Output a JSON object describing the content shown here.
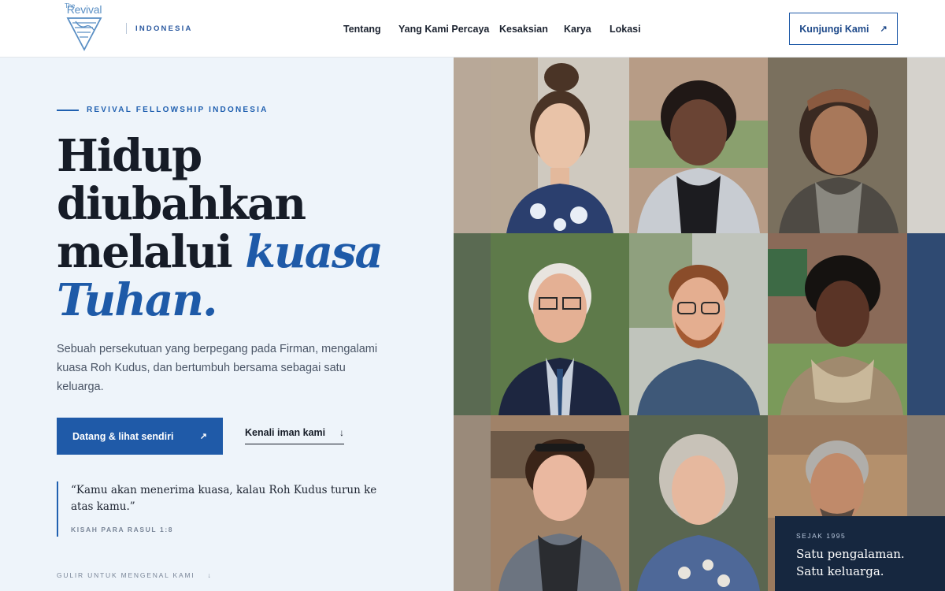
{
  "header": {
    "logo_text": "Revival",
    "logo_small": "The",
    "region": "INDONESIA",
    "nav": [
      {
        "label": "Tentang"
      },
      {
        "label": "Yang Kami Percaya"
      },
      {
        "label": "Kesaksian"
      },
      {
        "label": "Karya"
      },
      {
        "label": "Lokasi"
      }
    ],
    "cta_label": "Kunjungi Kami",
    "cta_icon": "arrow-up-right-icon"
  },
  "hero": {
    "eyebrow": "REVIVAL FELLOWSHIP INDONESIA",
    "headline_line1": "Hidup",
    "headline_line2": "diubahkan",
    "headline_line3a": "melalui ",
    "headline_line3b": "kuasa",
    "headline_line4": "Tuhan.",
    "description": "Sebuah persekutuan yang berpegang pada Firman, mengalami kuasa Roh Kudus, dan bertumbuh bersama sebagai satu keluarga.",
    "primary_button": "Datang & lihat sendiri",
    "secondary_button": "Kenali iman kami",
    "quote": "“Kamu akan menerima kuasa, kalau Roh Kudus turun ke atas kamu.”",
    "quote_ref": "KISAH PARA RASUL 1:8",
    "scroll_hint": "GULIR UNTUK MENGENAL KAMI",
    "colors": {
      "accent": "#1f5aa8",
      "background": "#eef4fa",
      "text": "#161c27"
    }
  },
  "badge": {
    "label": "SEJAK 1995",
    "line1": "Satu pengalaman.",
    "line2": "Satu keluarga."
  },
  "photos": [
    {
      "name": "portrait-woman-hair-bun"
    },
    {
      "name": "portrait-woman-grey-hoodie"
    },
    {
      "name": "portrait-woman-headband"
    },
    {
      "name": "portrait-elderly-man-glasses"
    },
    {
      "name": "portrait-man-red-hair-glasses"
    },
    {
      "name": "portrait-woman-curly-hair"
    },
    {
      "name": "portrait-woman-sunglasses-on-head"
    },
    {
      "name": "portrait-elderly-woman-grey-hair"
    },
    {
      "name": "portrait-man-grey-hair"
    }
  ]
}
